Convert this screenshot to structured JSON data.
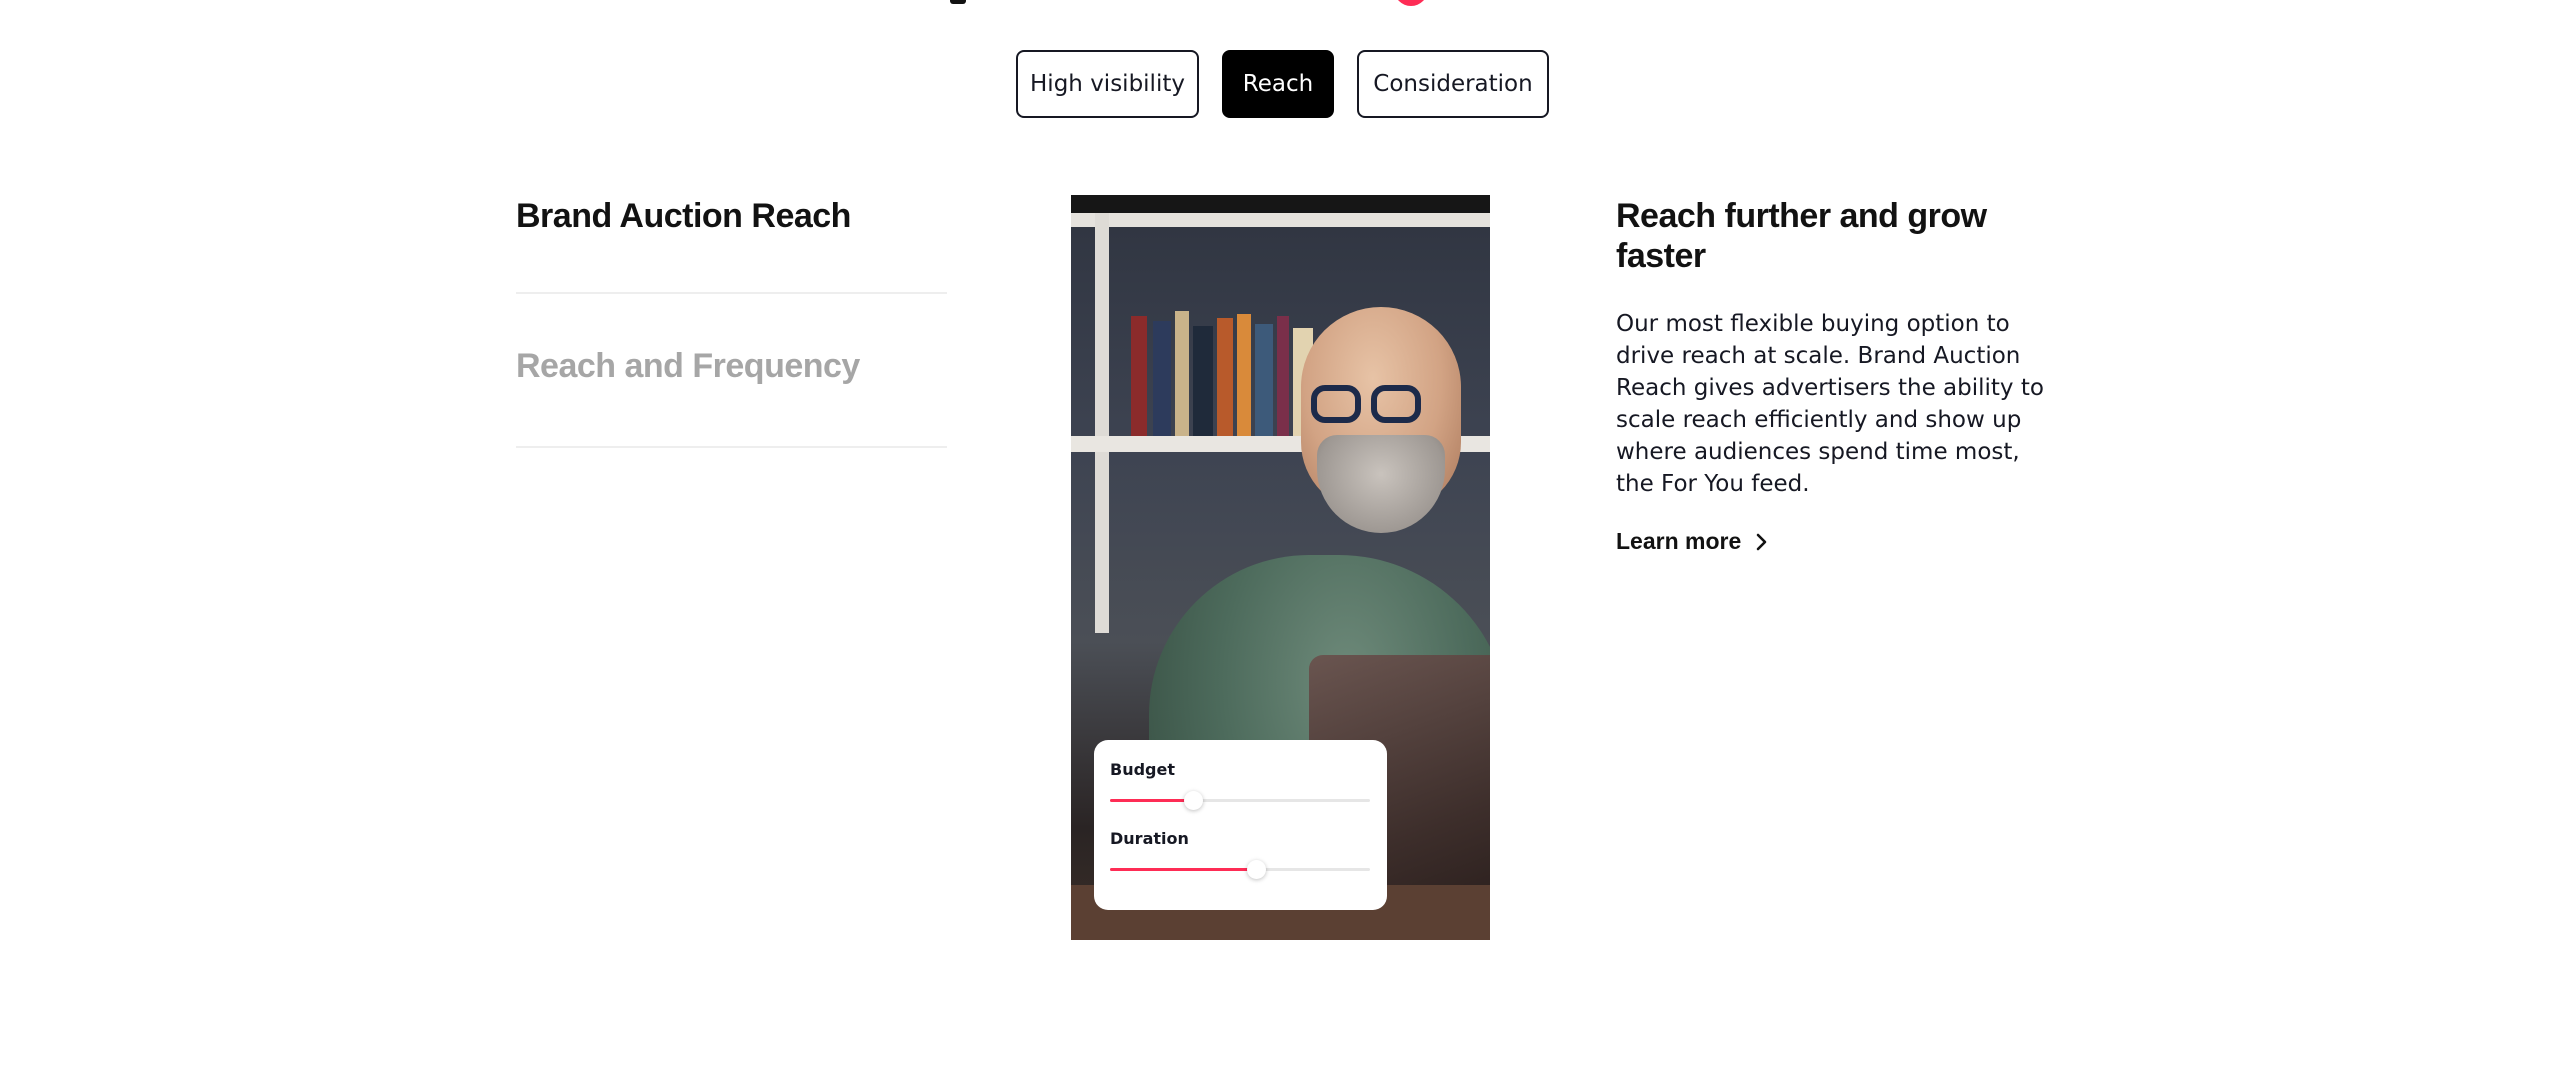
{
  "tabs": [
    {
      "label": "High visibility",
      "active": false
    },
    {
      "label": "Reach",
      "active": true
    },
    {
      "label": "Consideration",
      "active": false
    }
  ],
  "left_list": {
    "items": [
      {
        "label": "Brand Auction Reach",
        "active": true
      },
      {
        "label": "Reach and Frequency",
        "active": false
      }
    ]
  },
  "image_card": {
    "budget": {
      "label": "Budget",
      "value_fraction": 0.32
    },
    "duration": {
      "label": "Duration",
      "value_fraction": 0.56
    }
  },
  "detail": {
    "heading": "Reach further and grow faster",
    "body": "Our most flexible buying option to drive reach at scale. Brand Auction Reach gives advertisers the ability to scale reach efficiently and show up where audiences spend time most, the For You feed.",
    "learn_more": "Learn more"
  },
  "colors": {
    "accent": "#fe2c55",
    "active_tab_bg": "#000000",
    "inactive_text": "#a6a6a6"
  }
}
